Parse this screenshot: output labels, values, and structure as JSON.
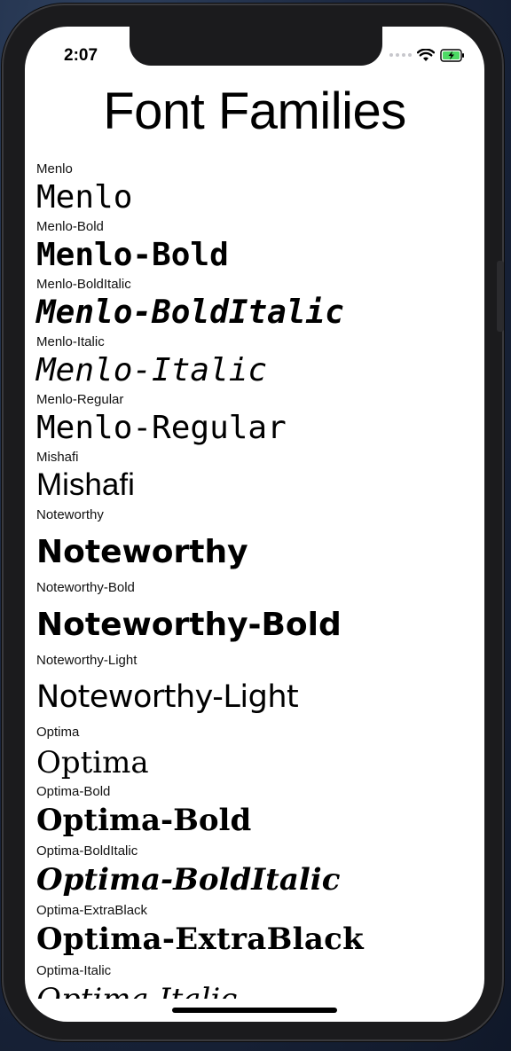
{
  "status_bar": {
    "time": "2:07",
    "icons": [
      "cellular-signal-icon",
      "wifi-icon",
      "battery-charging-icon"
    ]
  },
  "title": "Font Families",
  "fonts": [
    {
      "label": "Menlo",
      "sample": "Menlo"
    },
    {
      "label": "Menlo-Bold",
      "sample": "Menlo-Bold"
    },
    {
      "label": "Menlo-BoldItalic",
      "sample": "Menlo-BoldItalic"
    },
    {
      "label": "Menlo-Italic",
      "sample": "Menlo-Italic"
    },
    {
      "label": "Menlo-Regular",
      "sample": "Menlo-Regular"
    },
    {
      "label": "Mishafi",
      "sample": "Mishafi"
    },
    {
      "label": "Noteworthy",
      "sample": "Noteworthy"
    },
    {
      "label": "Noteworthy-Bold",
      "sample": "Noteworthy-Bold"
    },
    {
      "label": "Noteworthy-Light",
      "sample": "Noteworthy-Light"
    },
    {
      "label": "Optima",
      "sample": "Optima"
    },
    {
      "label": "Optima-Bold",
      "sample": "Optima-Bold"
    },
    {
      "label": "Optima-BoldItalic",
      "sample": "Optima-BoldItalic"
    },
    {
      "label": "Optima-ExtraBlack",
      "sample": "Optima-ExtraBlack"
    },
    {
      "label": "Optima-Italic",
      "sample": "Optima-Italic"
    }
  ]
}
